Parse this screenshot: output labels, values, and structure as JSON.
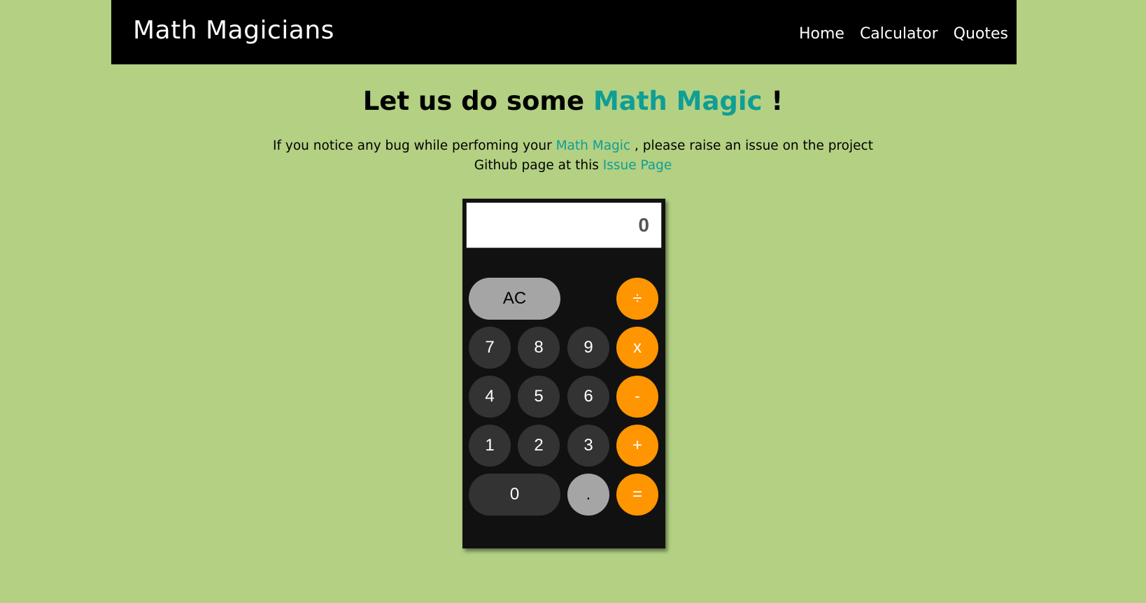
{
  "nav": {
    "brand": "Math Magicians",
    "links": [
      "Home",
      "Calculator",
      "Quotes"
    ]
  },
  "headline": {
    "prefix": "Let us do some ",
    "accent": "Math Magic",
    "suffix": " !"
  },
  "notice": {
    "part1": "If you notice any bug while perfoming your ",
    "accent": "Math Magic",
    "part2": " , please raise an issue on the project Github page at this ",
    "link": "Issue Page"
  },
  "calculator": {
    "display_value": "0",
    "buttons": {
      "ac": "AC",
      "divide": "÷",
      "seven": "7",
      "eight": "8",
      "nine": "9",
      "multiply": "x",
      "four": "4",
      "five": "5",
      "six": "6",
      "minus": "-",
      "one": "1",
      "two": "2",
      "three": "3",
      "plus": "+",
      "zero": "0",
      "decimal": ".",
      "equals": "="
    }
  },
  "colors": {
    "background": "#b3d083",
    "accent": "#0f9e94",
    "operator": "#ff9500",
    "digit": "#333333",
    "function": "#a5a5a5"
  }
}
